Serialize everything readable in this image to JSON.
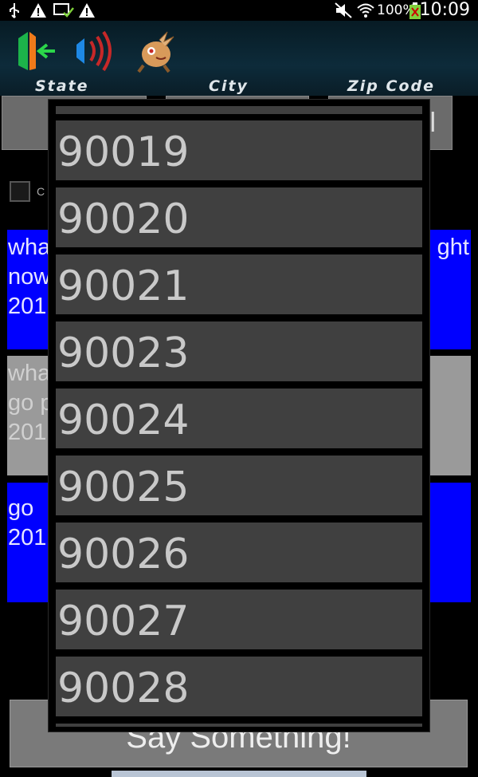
{
  "status_bar": {
    "battery": "100%",
    "time": "10:09",
    "icons": [
      "usb-icon",
      "warning-icon",
      "screen-check-icon",
      "warning-icon",
      "mute-icon",
      "wifi-icon",
      "battery-charging-icon"
    ]
  },
  "action_bar": {
    "buttons": [
      "exit-icon",
      "speaker-icon",
      "mascot-icon"
    ],
    "tabs": [
      "State",
      "City",
      "Zip Code"
    ]
  },
  "background": {
    "checkbox_label": "C",
    "posts": [
      {
        "line1": "wha",
        "line1_right": "ght",
        "line2": "now",
        "line3": "201"
      },
      {
        "line1": "wha",
        "line2": "go p",
        "line3": "201"
      },
      {
        "line1": "go",
        "line2": "201"
      }
    ],
    "say_button": "Say Something!"
  },
  "dropdown": {
    "items": [
      "90019",
      "90020",
      "90021",
      "90023",
      "90024",
      "90025",
      "90026",
      "90027",
      "90028"
    ]
  },
  "colors": {
    "post_blue": "#0000ff",
    "post_gray": "#9a9a9a",
    "item_bg": "#404040"
  }
}
